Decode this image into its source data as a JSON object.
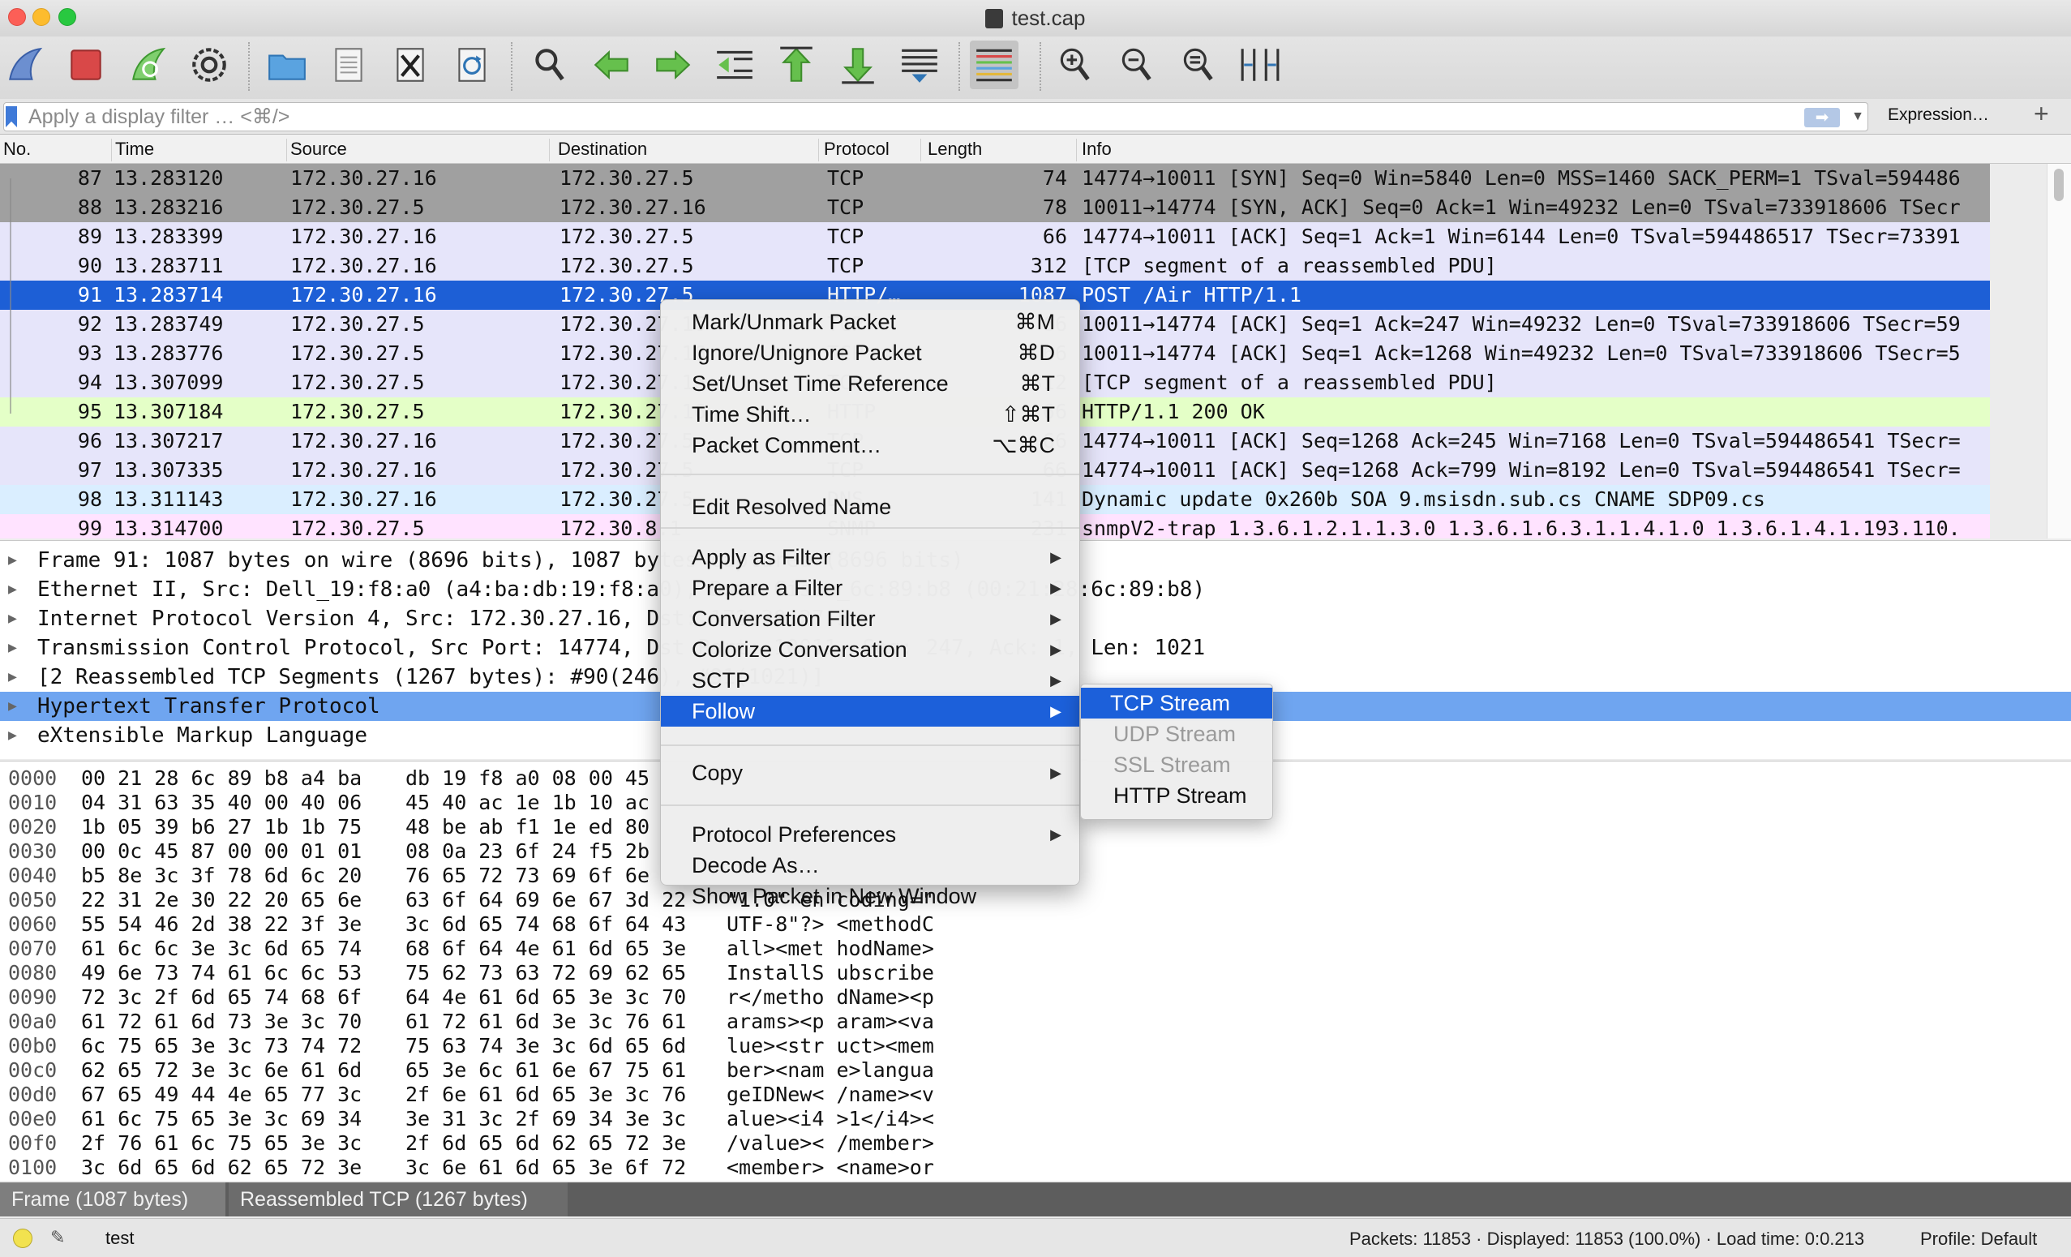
{
  "window": {
    "title": "test.cap"
  },
  "toolbar": {
    "icons": [
      "shark-fin-start-icon",
      "stop-icon",
      "restart-icon",
      "options-gear-icon",
      "open-folder-icon",
      "save-file-icon",
      "close-file-icon",
      "reload-icon",
      "find-icon",
      "back-arrow-icon",
      "forward-arrow-icon",
      "go-to-packet-icon",
      "first-packet-icon",
      "last-packet-icon",
      "autoscroll-icon",
      "colorize-icon",
      "zoom-in-icon",
      "zoom-out-icon",
      "zoom-normal-icon",
      "resize-columns-icon"
    ]
  },
  "filter": {
    "placeholder": "Apply a display filter … <⌘/>",
    "expression_label": "Expression…",
    "plus_label": "+"
  },
  "packet_list": {
    "columns": [
      "No.",
      "Time",
      "Source",
      "Destination",
      "Protocol",
      "Length",
      "Info"
    ],
    "rows": [
      {
        "no": "87",
        "time": "13.283120",
        "src": "172.30.27.16",
        "dst": "172.30.27.5",
        "proto": "TCP",
        "len": "74",
        "info": "14774→10011 [SYN] Seq=0 Win=5840 Len=0 MSS=1460 SACK_PERM=1 TSval=594486",
        "bg": "#a0a0a0"
      },
      {
        "no": "88",
        "time": "13.283216",
        "src": "172.30.27.5",
        "dst": "172.30.27.16",
        "proto": "TCP",
        "len": "78",
        "info": "10011→14774 [SYN, ACK] Seq=0 Ack=1 Win=49232 Len=0 TSval=733918606 TSecr",
        "bg": "#a0a0a0"
      },
      {
        "no": "89",
        "time": "13.283399",
        "src": "172.30.27.16",
        "dst": "172.30.27.5",
        "proto": "TCP",
        "len": "66",
        "info": "14774→10011 [ACK] Seq=1 Ack=1 Win=6144 Len=0 TSval=594486517 TSecr=73391",
        "bg": "#e6e5fa"
      },
      {
        "no": "90",
        "time": "13.283711",
        "src": "172.30.27.16",
        "dst": "172.30.27.5",
        "proto": "TCP",
        "len": "312",
        "info": "[TCP segment of a reassembled PDU]",
        "bg": "#e6e5fa"
      },
      {
        "no": "91",
        "time": "13.283714",
        "src": "172.30.27.16",
        "dst": "172.30.27.5",
        "proto": "HTTP/…",
        "len": "1087",
        "info": "POST /Air HTTP/1.1",
        "bg": "#1d5fd6",
        "selected": true
      },
      {
        "no": "92",
        "time": "13.283749",
        "src": "172.30.27.5",
        "dst": "172.30.27.16",
        "proto": "TCP",
        "len": "66",
        "info": "10011→14774 [ACK] Seq=1 Ack=247 Win=49232 Len=0 TSval=733918606 TSecr=59",
        "bg": "#e6e5fa"
      },
      {
        "no": "93",
        "time": "13.283776",
        "src": "172.30.27.5",
        "dst": "172.30.27.16",
        "proto": "TCP",
        "len": "66",
        "info": "10011→14774 [ACK] Seq=1 Ack=1268 Win=49232 Len=0 TSval=733918606 TSecr=5",
        "bg": "#e6e5fa"
      },
      {
        "no": "94",
        "time": "13.307099",
        "src": "172.30.27.5",
        "dst": "172.30.27.16",
        "proto": "TCP",
        "len": "312",
        "info": "[TCP segment of a reassembled PDU]",
        "bg": "#e6e5fa"
      },
      {
        "no": "95",
        "time": "13.307184",
        "src": "172.30.27.5",
        "dst": "172.30.27.16",
        "proto": "HTTP",
        "len": "66",
        "info": "HTTP/1.1 200 OK",
        "bg": "#e4ffc7"
      },
      {
        "no": "96",
        "time": "13.307217",
        "src": "172.30.27.16",
        "dst": "172.30.27.5",
        "proto": "TCP",
        "len": "66",
        "info": "14774→10011 [ACK] Seq=1268 Ack=245 Win=7168 Len=0 TSval=594486541 TSecr=",
        "bg": "#e6e5fa"
      },
      {
        "no": "97",
        "time": "13.307335",
        "src": "172.30.27.16",
        "dst": "172.30.27.5",
        "proto": "TCP",
        "len": "66",
        "info": "14774→10011 [ACK] Seq=1268 Ack=799 Win=8192 Len=0 TSval=594486541 TSecr=",
        "bg": "#e6e5fa"
      },
      {
        "no": "98",
        "time": "13.311143",
        "src": "172.30.27.16",
        "dst": "172.30.27.5",
        "proto": "DNS",
        "len": "141",
        "info": "Dynamic update 0x260b SOA 9.msisdn.sub.cs CNAME SDP09.cs",
        "bg": "#daeeff"
      },
      {
        "no": "99",
        "time": "13.314700",
        "src": "172.30.27.5",
        "dst": "172.30.8.1",
        "proto": "SNMP",
        "len": "231",
        "info": "snmpV2-trap 1.3.6.1.2.1.1.3.0 1.3.6.1.6.3.1.1.4.1.0 1.3.6.1.4.1.193.110.",
        "bg": "#ffe3ff"
      }
    ]
  },
  "details": {
    "rows": [
      "Frame 91: 1087 bytes on wire (8696 bits), 1087 bytes captured (8696 bits)",
      "Ethernet II, Src: Dell_19:f8:a0 (a4:ba:db:19:f8:a0), Dst: Cisco_6c:89:b8 (00:21:28:6c:89:b8)",
      "Internet Protocol Version 4, Src: 172.30.27.16, Dst: 172.30.27.5",
      "Transmission Control Protocol, Src Port: 14774, Dst Port: 10011, Seq: 247, Ack: 1, Len: 1021",
      "[2 Reassembled TCP Segments (1267 bytes): #90(246), #91(1021)]",
      "Hypertext Transfer Protocol",
      "eXtensible Markup Language"
    ]
  },
  "bytes": {
    "rows": [
      {
        "off": "0000",
        "hex1": "00 21 28 6c 89 b8 a4 ba",
        "hex2": "db 19 f8 a0 08 00 45",
        "ascii": ""
      },
      {
        "off": "0010",
        "hex1": "04 31 63 35 40 00 40 06",
        "hex2": "45 40 ac 1e 1b 10 ac",
        "ascii": ""
      },
      {
        "off": "0020",
        "hex1": "1b 05 39 b6 27 1b 1b 75",
        "hex2": "48 be ab f1 1e ed 80",
        "ascii": ""
      },
      {
        "off": "0030",
        "hex1": "00 0c 45 87 00 00 01 01",
        "hex2": "08 0a 23 6f 24 f5 2b",
        "ascii": ""
      },
      {
        "off": "0040",
        "hex1": "b5 8e 3c 3f 78 6d 6c 20",
        "hex2": "76 65 72 73 69 6f 6e",
        "ascii": ""
      },
      {
        "off": "0050",
        "hex1": "22 31 2e 30 22 20 65 6e",
        "hex2": "63 6f 64 69 6e 67 3d 22",
        "ascii": "\"1.0\" en coding=\""
      },
      {
        "off": "0060",
        "hex1": "55 54 46 2d 38 22 3f 3e",
        "hex2": "3c 6d 65 74 68 6f 64 43",
        "ascii": "UTF-8\"?> <methodC"
      },
      {
        "off": "0070",
        "hex1": "61 6c 6c 3e 3c 6d 65 74",
        "hex2": "68 6f 64 4e 61 6d 65 3e",
        "ascii": "all><met hodName>"
      },
      {
        "off": "0080",
        "hex1": "49 6e 73 74 61 6c 6c 53",
        "hex2": "75 62 73 63 72 69 62 65",
        "ascii": "InstallS ubscribe"
      },
      {
        "off": "0090",
        "hex1": "72 3c 2f 6d 65 74 68 6f",
        "hex2": "64 4e 61 6d 65 3e 3c 70",
        "ascii": "r</metho dName><p"
      },
      {
        "off": "00a0",
        "hex1": "61 72 61 6d 73 3e 3c 70",
        "hex2": "61 72 61 6d 3e 3c 76 61",
        "ascii": "arams><p aram><va"
      },
      {
        "off": "00b0",
        "hex1": "6c 75 65 3e 3c 73 74 72",
        "hex2": "75 63 74 3e 3c 6d 65 6d",
        "ascii": "lue><str uct><mem"
      },
      {
        "off": "00c0",
        "hex1": "62 65 72 3e 3c 6e 61 6d",
        "hex2": "65 3e 6c 61 6e 67 75 61",
        "ascii": "ber><nam e>langua"
      },
      {
        "off": "00d0",
        "hex1": "67 65 49 44 4e 65 77 3c",
        "hex2": "2f 6e 61 6d 65 3e 3c 76",
        "ascii": "geIDNew< /name><v"
      },
      {
        "off": "00e0",
        "hex1": "61 6c 75 65 3e 3c 69 34",
        "hex2": "3e 31 3c 2f 69 34 3e 3c",
        "ascii": "alue><i4 >1</i4><"
      },
      {
        "off": "00f0",
        "hex1": "2f 76 61 6c 75 65 3e 3c",
        "hex2": "2f 6d 65 6d 62 65 72 3e",
        "ascii": "/value>< /member>"
      },
      {
        "off": "0100",
        "hex1": "3c 6d 65 6d 62 65 72 3e",
        "hex2": "3c 6e 61 6d 65 3e 6f 72",
        "ascii": "<member> <name>or"
      }
    ]
  },
  "bytes_tabs": [
    "Frame (1087 bytes)",
    "Reassembled TCP (1267 bytes)"
  ],
  "status": {
    "file": "test",
    "summary": "Packets: 11853 · Displayed: 11853 (100.0%) · Load time: 0:0.213",
    "profile": "Profile: Default"
  },
  "context_menu": {
    "items": [
      {
        "label": "Mark/Unmark Packet",
        "shortcut": "⌘M"
      },
      {
        "label": "Ignore/Unignore Packet",
        "shortcut": "⌘D"
      },
      {
        "label": "Set/Unset Time Reference",
        "shortcut": "⌘T"
      },
      {
        "label": "Time Shift…",
        "shortcut": "⇧⌘T"
      },
      {
        "label": "Packet Comment…",
        "shortcut": "⌥⌘C"
      },
      {
        "label": "Edit Resolved Name",
        "shortcut": ""
      },
      {
        "label": "Apply as Filter",
        "submenu": true
      },
      {
        "label": "Prepare a Filter",
        "submenu": true
      },
      {
        "label": "Conversation Filter",
        "submenu": true
      },
      {
        "label": "Colorize Conversation",
        "submenu": true
      },
      {
        "label": "SCTP",
        "submenu": true
      },
      {
        "label": "Follow",
        "submenu": true,
        "active": true
      },
      {
        "label": "Copy",
        "submenu": true
      },
      {
        "label": "Protocol Preferences",
        "submenu": true
      },
      {
        "label": "Decode As…",
        "shortcut": ""
      },
      {
        "label": "Show Packet in New Window",
        "shortcut": ""
      }
    ],
    "arrow": "▶"
  },
  "follow_submenu": {
    "items": [
      {
        "label": "TCP Stream",
        "active": true
      },
      {
        "label": "UDP Stream",
        "disabled": true
      },
      {
        "label": "SSL Stream",
        "disabled": true
      },
      {
        "label": "HTTP Stream"
      }
    ]
  },
  "colors": {
    "selection": "#1c60da",
    "highlight_detail": "#6fa5f0"
  }
}
